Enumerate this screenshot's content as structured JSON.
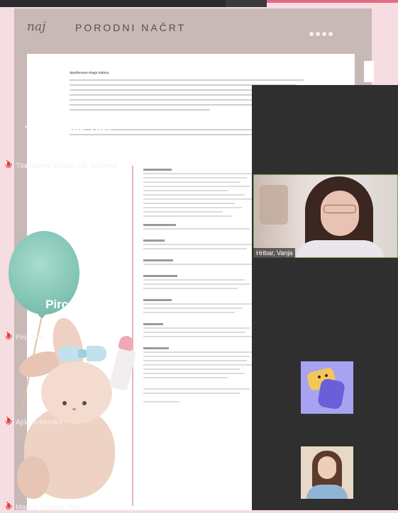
{
  "document": {
    "logo_text": "naj",
    "title": "PORODNI NAČRT",
    "greeting": "Spoštovano drago babico,"
  },
  "zoom": {
    "participants": [
      {
        "display_name": "Tita Stanek Zida...",
        "label": "Tita Stanek Zidaric EN, Slovenia",
        "muted": true
      },
      {
        "video_name": "Hribar, Vanja"
      },
      {
        "display_name": "Pirc, Anja",
        "label": "Pirc, Anja",
        "muted": true
      },
      {
        "label": "Ajda in Monika",
        "muted": true,
        "avatar": "cartoon-avatar"
      },
      {
        "label": "Manca, Martina, Ana",
        "muted": true,
        "avatar": "photo-avatar"
      }
    ]
  },
  "colors": {
    "panel_bg": "#2f2f2f",
    "mute_red": "#e23a3a",
    "doc_frame": "#c8b8b6",
    "page_bg": "#f6dde2"
  }
}
